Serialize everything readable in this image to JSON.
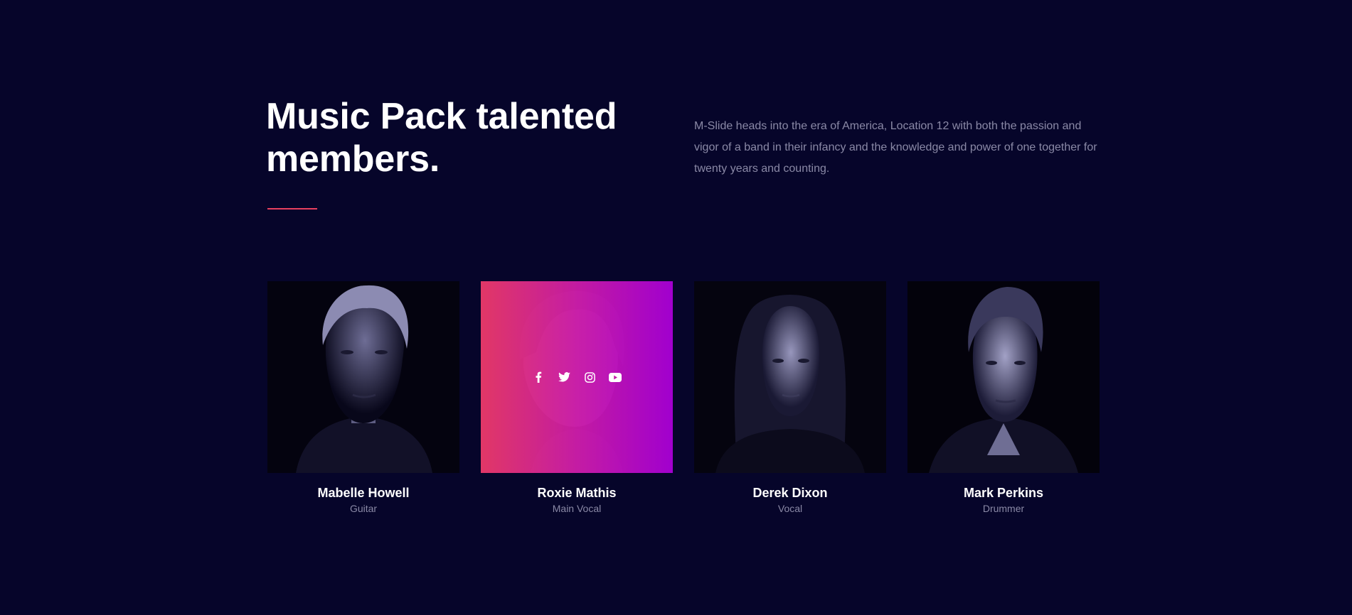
{
  "section": {
    "title": "Music Pack talented members.",
    "description": "M-Slide heads into the era of America, Location 12 with both the passion and vigor of a band in their infancy and the knowledge and power of one together for twenty years and counting."
  },
  "colors": {
    "background": "#06052a",
    "accent": "#e8405f",
    "overlay_start": "#e83969",
    "overlay_end": "#a600d4",
    "muted_text": "#8a89a6"
  },
  "members": [
    {
      "name": "Mabelle Howell",
      "role": "Guitar"
    },
    {
      "name": "Roxie Mathis",
      "role": "Main Vocal"
    },
    {
      "name": "Derek Dixon",
      "role": "Vocal"
    },
    {
      "name": "Mark Perkins",
      "role": "Drummer"
    }
  ],
  "social_icons": [
    "facebook-icon",
    "twitter-icon",
    "instagram-icon",
    "youtube-icon"
  ]
}
